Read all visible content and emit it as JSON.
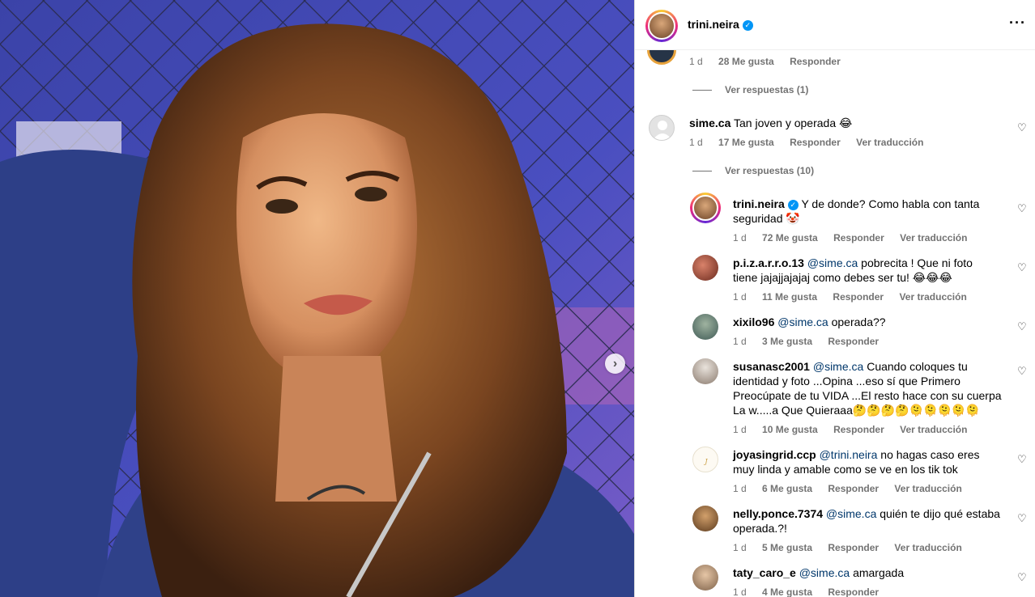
{
  "header": {
    "username": "trini.neira",
    "more_icon": "more-horizontal-icon"
  },
  "top_comment": {
    "time": "1 d",
    "likes": "28 Me gusta",
    "reply": "Responder",
    "view_replies": "Ver respuestas (1)"
  },
  "comment_main": {
    "username": "sime.ca",
    "text": "Tan joven y operada 😂",
    "time": "1 d",
    "likes": "17 Me gusta",
    "reply": "Responder",
    "translate": "Ver traducción",
    "view_replies": "Ver respuestas (10)"
  },
  "replies": [
    {
      "username": "trini.neira",
      "mention": "",
      "text": "Y de donde? Como habla con tanta seguridad 🤡",
      "time": "1 d",
      "likes": "72 Me gusta",
      "reply": "Responder",
      "translate": "Ver traducción"
    },
    {
      "username": "p.i.z.a.r.r.o.13",
      "mention": "@sime.ca",
      "text": "pobrecita ! Que ni foto tiene jajajjajajaj como debes ser tu! 😂😂😂",
      "time": "1 d",
      "likes": "11 Me gusta",
      "reply": "Responder",
      "translate": "Ver traducción"
    },
    {
      "username": "xixilo96",
      "mention": "@sime.ca",
      "text": "operada??",
      "time": "1 d",
      "likes": "3 Me gusta",
      "reply": "Responder",
      "translate": ""
    },
    {
      "username": "susanasc2001",
      "mention": "@sime.ca",
      "text": "Cuando coloques tu identidad y foto ...Opina ...eso sí que Primero Preocúpate de tu VIDA ...El resto hace con su cuerpa La w.....a Que Quieraaa🤔🤔🤔🤔🫠🫠🫠🫠🫠",
      "time": "1 d",
      "likes": "10 Me gusta",
      "reply": "Responder",
      "translate": "Ver traducción"
    },
    {
      "username": "joyasingrid.ccp",
      "mention": "@trini.neira",
      "text": "no hagas caso eres muy linda y amable como se ve en los tik tok",
      "time": "1 d",
      "likes": "6 Me gusta",
      "reply": "Responder",
      "translate": "Ver traducción"
    },
    {
      "username": "nelly.ponce.7374",
      "mention": "@sime.ca",
      "text": "quién te dijo qué estaba operada.?!",
      "time": "1 d",
      "likes": "5 Me gusta",
      "reply": "Responder",
      "translate": "Ver traducción"
    },
    {
      "username": "taty_caro_e",
      "mention": "@sime.ca",
      "text": "amargada",
      "time": "1 d",
      "likes": "4 Me gusta",
      "reply": "Responder",
      "translate": ""
    }
  ],
  "photo": {
    "next_icon": "chevron-right-icon"
  }
}
